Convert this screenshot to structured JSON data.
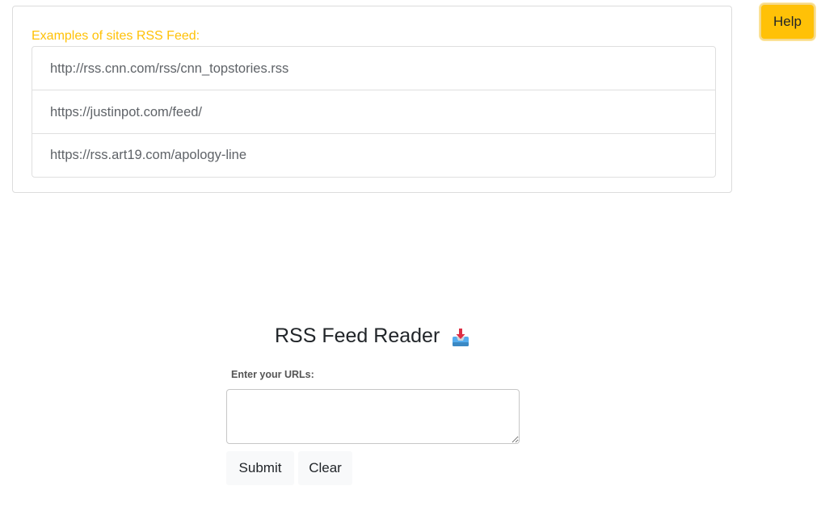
{
  "examples": {
    "title": "Examples of sites RSS Feed:",
    "items": [
      "http://rss.cnn.com/rss/cnn_topstories.rss",
      "https://justinpot.com/feed/",
      "https://rss.art19.com/apology-line"
    ]
  },
  "help": {
    "label": "Help"
  },
  "reader": {
    "title": "RSS Feed Reader",
    "title_icon": "inbox-tray-icon",
    "url_label": "Enter your URLs:",
    "url_value": "",
    "submit_label": "Submit",
    "clear_label": "Clear"
  },
  "colors": {
    "accent": "#ffc107",
    "button_light": "#f8f9fa",
    "text": "#212529"
  }
}
